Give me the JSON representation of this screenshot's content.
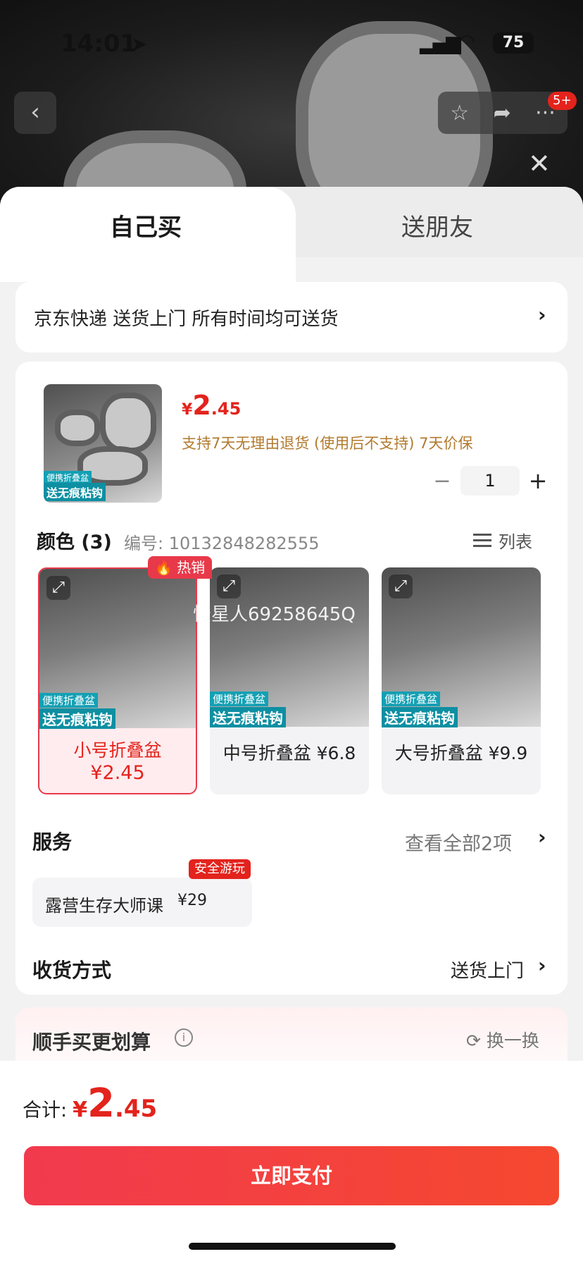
{
  "status_bar": {
    "time": "14:01",
    "battery": "75"
  },
  "nav": {
    "badge": "5+"
  },
  "tabs": {
    "self": "自己买",
    "friend": "送朋友"
  },
  "delivery": {
    "text": "京东快递 送货上门 所有时间均可送货"
  },
  "product": {
    "price_currency": "¥",
    "price_int": "2",
    "price_dec": ".45",
    "policy": "支持7天无理由退货 (使用后不支持)  7天价保",
    "quantity": "1",
    "thumb_tag1": "便携折叠盆",
    "thumb_tag2": "送无痕粘钩"
  },
  "color": {
    "title": "颜色 (3)",
    "code": "编号: 10132848282555",
    "list_label": "列表"
  },
  "variants": [
    {
      "label": "小号折叠盆",
      "price": "¥2.45",
      "tag1": "便携折叠盆",
      "tag2": "送无痕粘钩"
    },
    {
      "label": "中号折叠盆  ¥6.8",
      "tag1": "便携折叠盆",
      "tag2": "送无痕粘钩"
    },
    {
      "label": "大号折叠盆  ¥9.9",
      "tag1": "便携折叠盆",
      "tag2": "送无痕粘钩"
    }
  ],
  "hot_badge": "热销",
  "watermark": "憬星人69258645Q",
  "service": {
    "title": "服务",
    "view_all": "查看全部2项",
    "chip_name": "露营生存大师课",
    "chip_price": "¥29",
    "chip_badge": "安全游玩"
  },
  "shipping": {
    "title": "收货方式",
    "value": "送货上门"
  },
  "addon": {
    "title": "顺手买更划算",
    "refresh": "换一换"
  },
  "footer": {
    "total_label": "合计:",
    "total_currency": "¥",
    "total_int": "2",
    "total_dec": ".45",
    "pay_label": "立即支付"
  },
  "colors": {
    "accent": "#e3231c",
    "policy": "#b27a2e"
  }
}
